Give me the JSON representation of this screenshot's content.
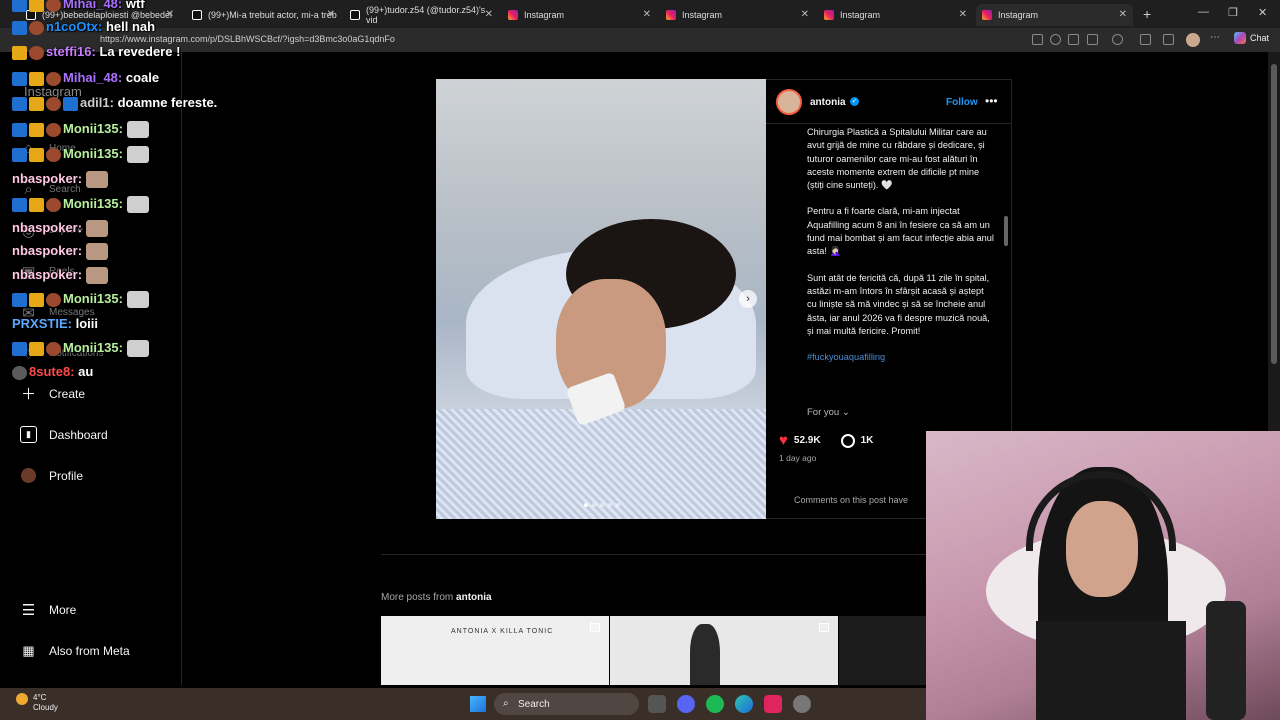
{
  "browser": {
    "tabs": [
      {
        "label": "(99+)bebedelaploiesti @bebedel"
      },
      {
        "label": "(99+)Mi-a trebuit actor, mi-a treb"
      },
      {
        "label": "(99+)tudor.z54 (@tudor.z54)'s vid"
      },
      {
        "label": "Instagram"
      },
      {
        "label": "Instagram"
      },
      {
        "label": "Instagram"
      },
      {
        "label": "Instagram"
      }
    ],
    "new_tab": "+",
    "url": "https://www.instagram.com/p/DSLBhWSCBcf/?igsh=d3Bmc3o0aG1qdnFo",
    "chat_label": "Chat"
  },
  "sidebar": {
    "logo": "Instagram",
    "items": [
      {
        "label": "Home",
        "icon": "home-icon"
      },
      {
        "label": "Search",
        "icon": "search-icon"
      },
      {
        "label": "Explore",
        "icon": "compass-icon"
      },
      {
        "label": "Reels",
        "icon": "reels-icon"
      },
      {
        "label": "Messages",
        "icon": "messenger-icon"
      },
      {
        "label": "Notifications",
        "icon": "heart-icon"
      },
      {
        "label": "Create",
        "icon": "plus-icon"
      },
      {
        "label": "Dashboard",
        "icon": "dashboard-icon"
      },
      {
        "label": "Profile",
        "icon": "profile-avatar"
      }
    ],
    "bottom": [
      {
        "label": "More",
        "icon": "hamburger-icon"
      },
      {
        "label": "Also from Meta",
        "icon": "meta-icon"
      }
    ]
  },
  "post": {
    "username": "antonia",
    "follow_label": "Follow",
    "caption": [
      "Chirurgia Plastică a Spitalului Militar care au avut grijă de mine cu răbdare și dedicare, și tuturor oamenilor care mi-au fost alături în aceste momente extrem de dificile pt mine (știți cine sunteți). 🤍",
      "Pentru a fi foarte clară, mi-am injectat Aquafilling acum 8 ani în fesiere ca să am un fund mai bombat și am facut infecție abia anul asta! 🤦🏻‍♀️",
      "Sunt atât de fericită că, după 11 zile în spital, astăzi m-am întors în sfârșit acasă și aștept cu liniște să mă vindec și să se încheie anul ăsta, iar anul 2026 va fi despre muzică nouă, și mai multă fericire. Promit!"
    ],
    "hashtag": "#fuckyouaquafilling",
    "for_you": "For you",
    "likes": "52.9K",
    "comments": "1K",
    "time_ago": "1 day ago",
    "comments_limited": "Comments on this post have",
    "carousel_index": 1,
    "carousel_count": 5
  },
  "more_posts": {
    "prefix": "More posts from",
    "user": "antonia",
    "thumb1_text": "ANTONIA X KILLA TONIC"
  },
  "chat": [
    {
      "user": "Mihai_48",
      "color": "#a970ff",
      "msg": "wtf"
    },
    {
      "user": "n1coOtx",
      "color": "#1e90ff",
      "msg": "hell nah"
    },
    {
      "user": "steffi16",
      "color": "#c77dff",
      "msg": "La revedere !"
    },
    {
      "user": "Mihai_48",
      "color": "#a970ff",
      "msg": "coale"
    },
    {
      "user": "adil1",
      "color": "#cccccc",
      "msg": "doamne fereste."
    },
    {
      "user": "Monii135",
      "color": "#b6f09c",
      "msg": ""
    },
    {
      "user": "Monii135",
      "color": "#b6f09c",
      "msg": ""
    },
    {
      "user": "nbaspoker",
      "color": "#ffc7e0",
      "msg": ""
    },
    {
      "user": "Monii135",
      "color": "#b6f09c",
      "msg": ""
    },
    {
      "user": "nbaspoker",
      "color": "#ffc7e0",
      "msg": ""
    },
    {
      "user": "nbaspoker",
      "color": "#ffc7e0",
      "msg": ""
    },
    {
      "user": "nbaspoker",
      "color": "#ffc7e0",
      "msg": ""
    },
    {
      "user": "Monii135",
      "color": "#b6f09c",
      "msg": ""
    },
    {
      "user": "PRXSTIE",
      "color": "#5aa9ff",
      "msg": "loiii"
    },
    {
      "user": "Monii135",
      "color": "#b6f09c",
      "msg": ""
    },
    {
      "user": "8sute8",
      "color": "#ff4a4a",
      "msg": "au"
    }
  ],
  "taskbar": {
    "temp": "4°C",
    "condition": "Cloudy",
    "search": "Search"
  }
}
